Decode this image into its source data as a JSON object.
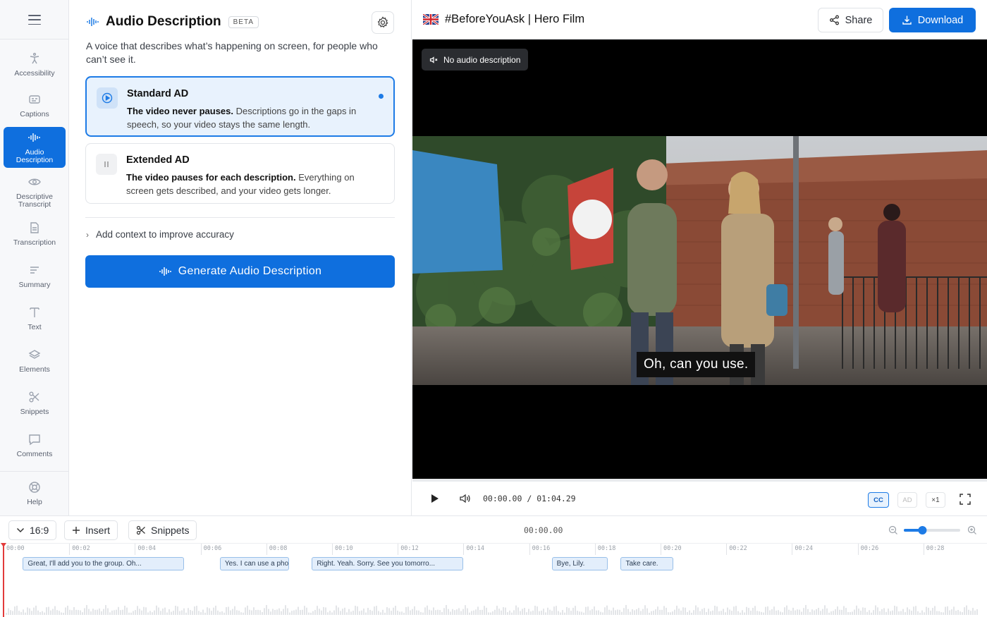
{
  "rail": {
    "items": [
      {
        "label": "Accessibility",
        "icon": "accessibility-icon",
        "active": false
      },
      {
        "label": "Captions",
        "icon": "captions-icon",
        "active": false
      },
      {
        "label": "Audio Description",
        "icon": "audio-wave-icon",
        "active": true
      },
      {
        "label": "Descriptive Transcript",
        "icon": "eye-icon",
        "active": false
      },
      {
        "label": "Transcription",
        "icon": "document-icon",
        "active": false
      },
      {
        "label": "Summary",
        "icon": "summary-lines-icon",
        "active": false
      },
      {
        "label": "Text",
        "icon": "text-icon",
        "active": false
      },
      {
        "label": "Elements",
        "icon": "layers-icon",
        "active": false
      },
      {
        "label": "Snippets",
        "icon": "scissors-icon",
        "active": false
      },
      {
        "label": "Comments",
        "icon": "comment-icon",
        "active": false
      }
    ],
    "help_label": "Help"
  },
  "panel": {
    "title": "Audio Description",
    "badge": "BETA",
    "description": "A voice that describes what’s happening on screen, for people who can’t see it.",
    "options": [
      {
        "title": "Standard AD",
        "bold": "The video never pauses.",
        "body": " Descriptions go in the gaps in speech, so your video stays the same length.",
        "selected": true
      },
      {
        "title": "Extended AD",
        "bold": "The video pauses for each description.",
        "body": " Everything on screen gets described, and your video gets longer.",
        "selected": false
      }
    ],
    "context_label": "Add context to improve accuracy",
    "generate_label": "Generate Audio Description"
  },
  "topbar": {
    "title": "#BeforeYouAsk | Hero Film",
    "share_label": "Share",
    "download_label": "Download"
  },
  "player": {
    "ad_status": "No audio description",
    "subtitle": "Oh, can you use.",
    "current_time": "00:00.00",
    "separator": "/",
    "duration": "01:04.29",
    "cc_label": "CC",
    "ad_label": "AD",
    "speed_label": "×1"
  },
  "timeline": {
    "aspect_label": "16:9",
    "insert_label": "Insert",
    "snippets_label": "Snippets",
    "time": "00:00.00",
    "zoom_level": 0.33,
    "ticks": [
      "00:00",
      "00:02",
      "00:04",
      "00:06",
      "00:08",
      "00:10",
      "00:12",
      "00:14",
      "00:16",
      "00:18",
      "00:20",
      "00:22",
      "00:24",
      "00:26",
      "00:28"
    ],
    "clips": [
      {
        "text": "Great, I'll add you to the group. Oh...",
        "start": 0.2,
        "end": 5.1
      },
      {
        "text": "Yes. I can use a phone.",
        "start": 6.2,
        "end": 8.3
      },
      {
        "text": "Right. Yeah. Sorry. See you tomorro...",
        "start": 9.0,
        "end": 13.6
      },
      {
        "text": "Bye, Lily.",
        "start": 16.3,
        "end": 18.0
      },
      {
        "text": "Take care.",
        "start": 18.4,
        "end": 20.0
      }
    ]
  },
  "colors": {
    "accent": "#0f6fde",
    "playhead": "#e23b3b"
  }
}
